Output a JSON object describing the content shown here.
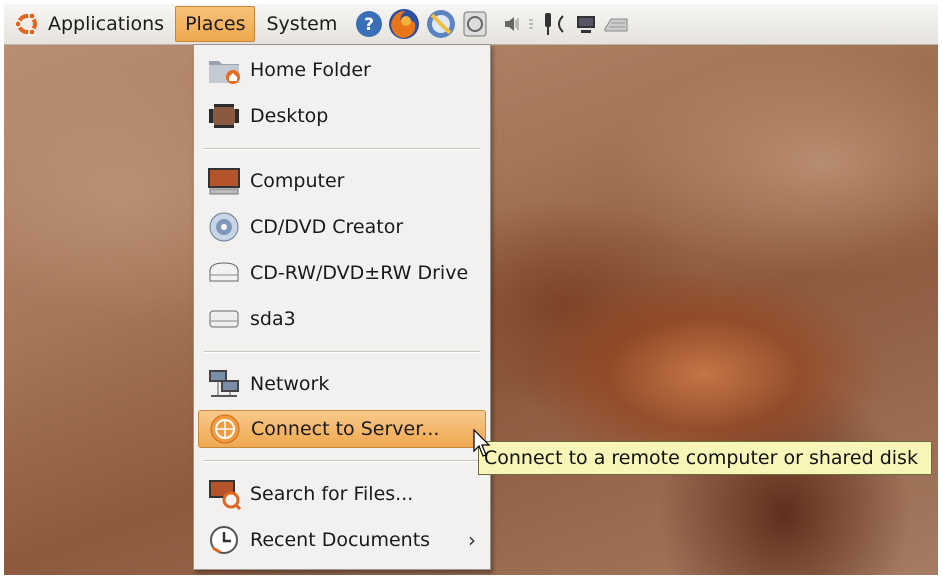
{
  "panel": {
    "menus": [
      "Applications",
      "Places",
      "System"
    ],
    "active_menu": "Places",
    "launchers": [
      "help-icon",
      "firefox-icon",
      "mail-icon",
      "system-monitor-icon"
    ],
    "tray": [
      "volume-icon",
      "mixer-icon",
      "network-icon",
      "display-icon",
      "keyboard-icon"
    ]
  },
  "places_menu": {
    "items": [
      {
        "label": "Home Folder",
        "icon": "home-folder-icon"
      },
      {
        "label": "Desktop",
        "icon": "desktop-icon"
      },
      {
        "label": "Computer",
        "icon": "computer-icon"
      },
      {
        "label": "CD/DVD Creator",
        "icon": "cd-icon"
      },
      {
        "label": "CD-RW/DVD±RW Drive",
        "icon": "optical-drive-icon"
      },
      {
        "label": "sda3",
        "icon": "hard-disk-icon"
      },
      {
        "label": "Network",
        "icon": "network-icon"
      },
      {
        "label": "Connect to Server...",
        "icon": "connect-server-icon"
      },
      {
        "label": "Search for Files...",
        "icon": "search-files-icon"
      },
      {
        "label": "Recent Documents",
        "icon": "recent-documents-icon"
      }
    ],
    "highlighted": "Connect to Server...",
    "submenu_arrow": "›"
  },
  "tooltip": {
    "text": "Connect to a remote computer or shared disk"
  },
  "colors": {
    "highlight": "#efa850",
    "tooltip_bg": "#f7f5b8",
    "panel_bg": "#eeece8"
  }
}
